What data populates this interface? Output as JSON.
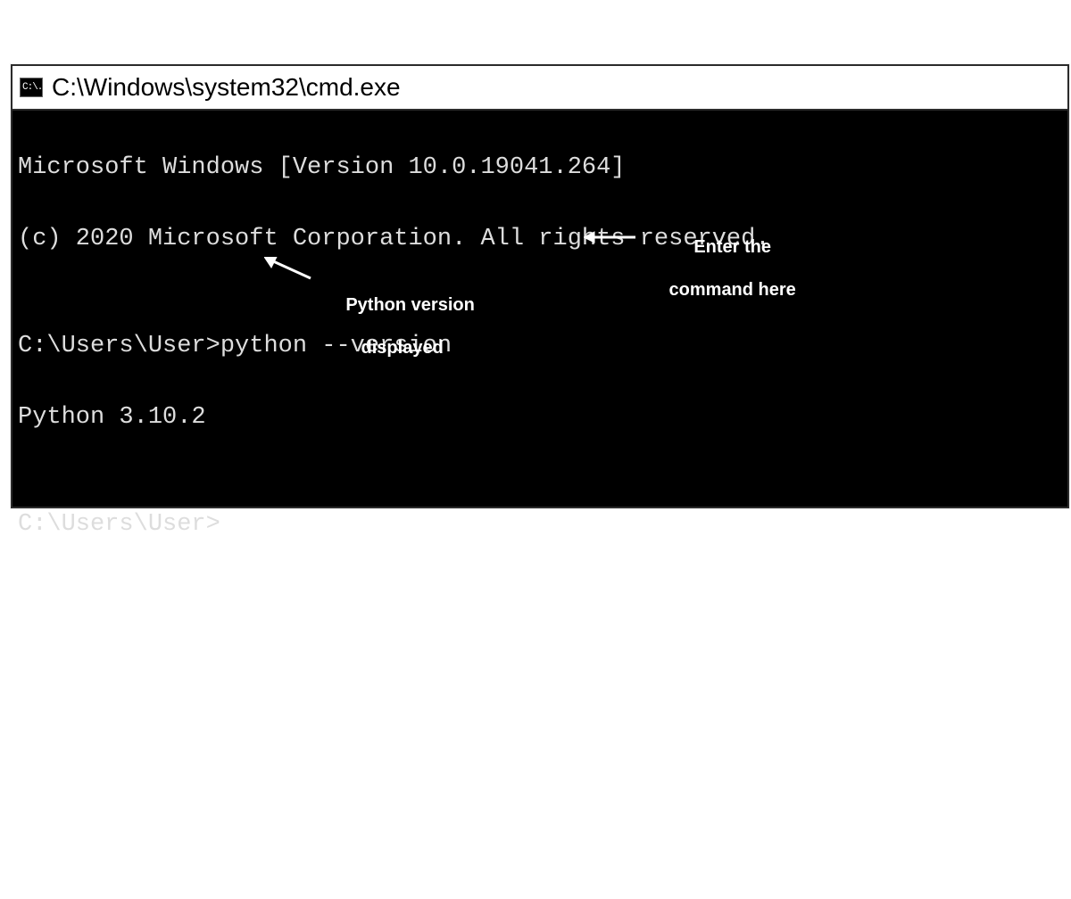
{
  "window": {
    "icon_glyph": "C:\\.",
    "title": "C:\\Windows\\system32\\cmd.exe"
  },
  "terminal": {
    "line1": "Microsoft Windows [Version 10.0.19041.264]",
    "line2": "(c) 2020 Microsoft Corporation. All rights reserved.",
    "blank1": "",
    "prompt_with_cmd": "C:\\Users\\User>python --version",
    "output": "Python 3.10.2",
    "blank2": "",
    "prompt_empty": "C:\\Users\\User>"
  },
  "annotations": {
    "command_hint_line1": "Enter the",
    "command_hint_line2": "command here",
    "version_hint_line1": "Python version",
    "version_hint_line2": "displayed"
  }
}
